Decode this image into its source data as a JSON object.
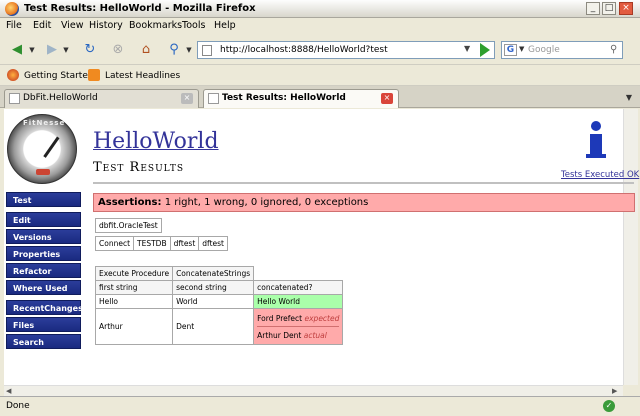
{
  "window": {
    "title": "Test Results: HelloWorld - Mozilla Firefox"
  },
  "menus": [
    "File",
    "Edit",
    "View",
    "History",
    "Bookmarks",
    "Tools",
    "Help"
  ],
  "nav": {
    "url": "http://localhost:8888/HelloWorld?test",
    "search_placeholder": "Google",
    "search_engine_icon": "G"
  },
  "bookmarks": [
    {
      "label": "Getting Started",
      "icon": "firefox-icon"
    },
    {
      "label": "Latest Headlines",
      "icon": "rss-icon"
    }
  ],
  "tabs": [
    {
      "label": "DbFit.HelloWorld",
      "active": false
    },
    {
      "label": "Test Results: HelloWorld",
      "active": true
    }
  ],
  "page": {
    "title": "HelloWorld",
    "subtitle": "Test Results",
    "tests_link": "Tests Executed OK",
    "logo_text": "FitNesse",
    "sidebar": [
      "Test",
      "Edit",
      "Versions",
      "Properties",
      "Refactor",
      "Where Used",
      "RecentChanges",
      "Files",
      "Search"
    ],
    "assertions": "Assertions: 1 right, 1 wrong, 0 ignored, 0 exceptions",
    "table1": {
      "cell": "dbfit.OracleTest"
    },
    "table2": {
      "cells": [
        "Connect",
        "TESTDB",
        "dftest",
        "dftest"
      ]
    },
    "table3": {
      "header": [
        "Execute Procedure",
        "ConcatenateStrings"
      ],
      "columns": [
        "first string",
        "second string",
        "concatenated?"
      ],
      "row1": [
        "Hello",
        "World",
        "Hello World"
      ],
      "row2": [
        "Arthur",
        "Dent"
      ],
      "row2_expected": "Ford Prefect",
      "row2_expected_label": "expected",
      "row2_actual": "Arthur Dent",
      "row2_actual_label": "actual"
    }
  },
  "status": {
    "text": "Done"
  },
  "colors": {
    "pass": "#aaffaa",
    "fail": "#ffaaaa",
    "link": "#333399",
    "sidebar": "#1a2a80"
  }
}
